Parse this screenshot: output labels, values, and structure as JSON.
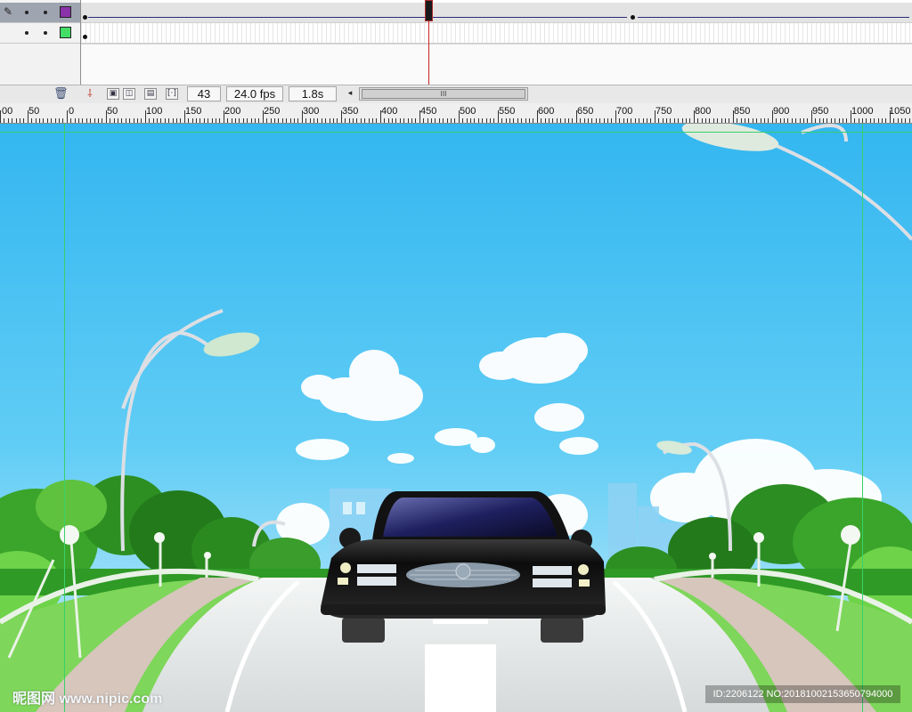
{
  "timeline": {
    "layers": [
      {
        "swatch_color": "#8a32a8",
        "selected": true
      },
      {
        "swatch_color": "#44dd66",
        "selected": false
      }
    ],
    "current_frame": "43",
    "frame_rate": "24.0 fps",
    "elapsed_time": "1.8s"
  },
  "ruler": {
    "labels": [
      "00",
      "50",
      "0",
      "50",
      "100",
      "150",
      "200",
      "250",
      "300",
      "350",
      "400",
      "450",
      "500",
      "550",
      "600",
      "650",
      "700",
      "750",
      "800",
      "850",
      "900",
      "950",
      "1000",
      "1050"
    ]
  },
  "stage": {
    "description_colors": {
      "sky": "#43b9ef",
      "car": "#111111",
      "road": "#e6eaea"
    },
    "watermark_left": "昵图网 www.nipic.com",
    "watermark_right": "ID:2206122 NO:20181002153650794000"
  }
}
